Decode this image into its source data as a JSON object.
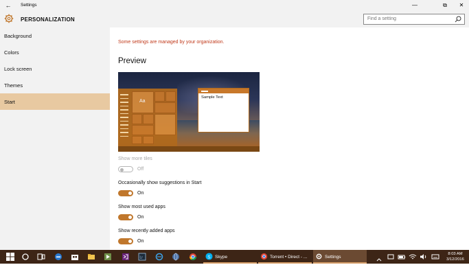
{
  "window": {
    "title": "Settings",
    "back_glyph": "←",
    "controls": {
      "minimize": "—",
      "maximize": "⧉",
      "close": "✕"
    }
  },
  "header": {
    "section_title": "PERSONALIZATION",
    "search_placeholder": "Find a setting"
  },
  "sidebar": {
    "items": [
      {
        "label": "Background"
      },
      {
        "label": "Colors"
      },
      {
        "label": "Lock screen"
      },
      {
        "label": "Themes"
      },
      {
        "label": "Start",
        "selected": true
      }
    ]
  },
  "main": {
    "org_message": "Some settings are managed by your organization.",
    "preview_heading": "Preview",
    "preview": {
      "tile_text": "Aa",
      "window_text": "Sample Text"
    },
    "settings": [
      {
        "label": "Show more tiles",
        "state": "Off",
        "on": false,
        "disabled": true
      },
      {
        "label": "Occasionally show suggestions in Start",
        "state": "On",
        "on": true,
        "disabled": false
      },
      {
        "label": "Show most used apps",
        "state": "On",
        "on": true,
        "disabled": false
      },
      {
        "label": "Show recently added apps",
        "state": "On",
        "on": true,
        "disabled": false
      }
    ]
  },
  "taskbar": {
    "apps": [
      {
        "label": "Skype",
        "icon": "skype-icon"
      },
      {
        "label": "Torrent • Direct - ...",
        "icon": "chrome-icon"
      },
      {
        "label": "Settings",
        "icon": "gear-icon",
        "active": true
      }
    ],
    "clock": {
      "time": "8:03 AM",
      "date": "3/12/2016"
    }
  },
  "colors": {
    "accent": "#c0772c",
    "taskbar": "#3d2516",
    "selected_nav": "#e8c9a1",
    "org_message": "#c0391a"
  }
}
